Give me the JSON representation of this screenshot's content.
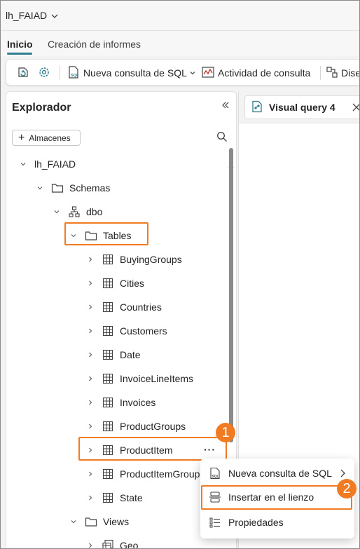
{
  "workspace": {
    "name": "lh_FAIAD"
  },
  "ribbon": {
    "tabs": [
      {
        "label": "Inicio"
      },
      {
        "label": "Creación de informes"
      }
    ]
  },
  "toolbar": {
    "new_sql_query": "Nueva consulta de SQL",
    "query_activity": "Actividad de consulta",
    "design_truncated": "Dise"
  },
  "explorer": {
    "title": "Explorador",
    "add_warehouses": "Almacenes",
    "tree": {
      "root": "lh_FAIAD",
      "schemas": "Schemas",
      "dbo": "dbo",
      "tables": "Tables",
      "table_items": [
        "BuyingGroups",
        "Cities",
        "Countries",
        "Customers",
        "Date",
        "InvoiceLineItems",
        "Invoices",
        "ProductGroups",
        "ProductItem",
        "ProductItemGroup",
        "State"
      ],
      "views": "Views",
      "view_items": [
        "Geo"
      ]
    },
    "more_options": "···"
  },
  "editor": {
    "tab_title": "Visual query 4"
  },
  "context_menu": {
    "items": [
      {
        "label": "Nueva consulta de SQL"
      },
      {
        "label": "Insertar en el lienzo"
      },
      {
        "label": "Propiedades"
      }
    ]
  },
  "callouts": {
    "one": "1",
    "two": "2"
  },
  "colors": {
    "highlight": "#f07b22",
    "accent": "#2e7d8c",
    "text": "#242424"
  }
}
